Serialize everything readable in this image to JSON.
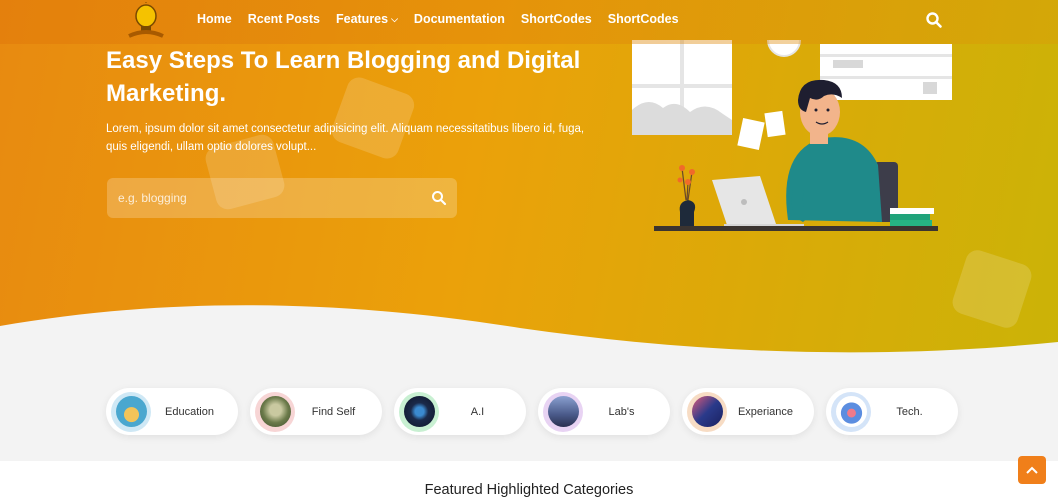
{
  "nav": {
    "items": [
      {
        "label": "Home"
      },
      {
        "label": "Rcent Posts"
      },
      {
        "label": "Features",
        "has_dropdown": true
      },
      {
        "label": "Documentation"
      },
      {
        "label": "ShortCodes"
      },
      {
        "label": "ShortCodes"
      }
    ],
    "search_icon": "search-icon"
  },
  "hero": {
    "title": "Easy Steps To Learn Blogging and Digital Marketing.",
    "description": "Lorem, ipsum dolor sit amet consectetur adipisicing elit. Aliquam necessitatibus libero id, fuga, quis eligendi, ullam optio dolores volupt...",
    "search_placeholder": "e.g. blogging"
  },
  "categories": [
    {
      "label": "Education",
      "ring": "#cfe8f5",
      "icon": "#4aa7cf"
    },
    {
      "label": "Find Self",
      "ring": "#f7d5d5",
      "icon": "#6b7a4a"
    },
    {
      "label": "A.I",
      "ring": "#c8f0d2",
      "icon": "#1b2a4a"
    },
    {
      "label": "Lab's",
      "ring": "#e8d3f3",
      "icon": "#4a5a8a"
    },
    {
      "label": "Experiance",
      "ring": "#f7dcc4",
      "icon": "#2a3a8a"
    },
    {
      "label": "Tech.",
      "ring": "#d4e4f8",
      "icon": "#5b8de0"
    }
  ],
  "section": {
    "title": "Featured Highlighted Categories"
  },
  "colors": {
    "accent": "#f07f1a",
    "hero_start": "#e88a10",
    "hero_end": "#cbb307"
  }
}
